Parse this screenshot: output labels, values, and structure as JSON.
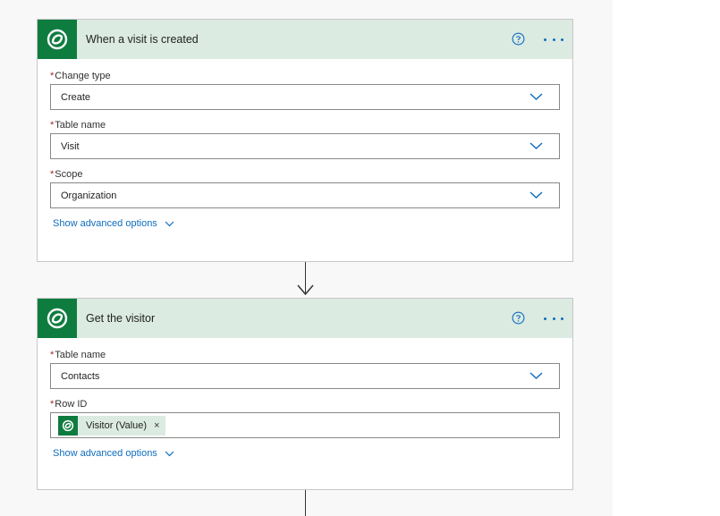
{
  "cards": [
    {
      "title": "When a visit is created",
      "fields": [
        {
          "label": "Change type",
          "value": "Create"
        },
        {
          "label": "Table name",
          "value": "Visit"
        },
        {
          "label": "Scope",
          "value": "Organization"
        }
      ],
      "advanced": "Show advanced options"
    },
    {
      "title": "Get the visitor",
      "fields": [
        {
          "label": "Table name",
          "value": "Contacts"
        },
        {
          "label": "Row ID",
          "token": "Visitor (Value)",
          "token_remove": "×"
        }
      ],
      "advanced": "Show advanced options"
    }
  ],
  "required_marker": "*",
  "colors": {
    "header_bg": "#dbebe2",
    "brand_green": "#0f7c3f",
    "link_blue": "#0f6cbd",
    "required_red": "#a4262c"
  },
  "icons": [
    "dataverse-logo-icon",
    "help-icon",
    "more-options-icon",
    "chevron-down-icon",
    "arrow-down-icon",
    "remove-token-icon"
  ]
}
